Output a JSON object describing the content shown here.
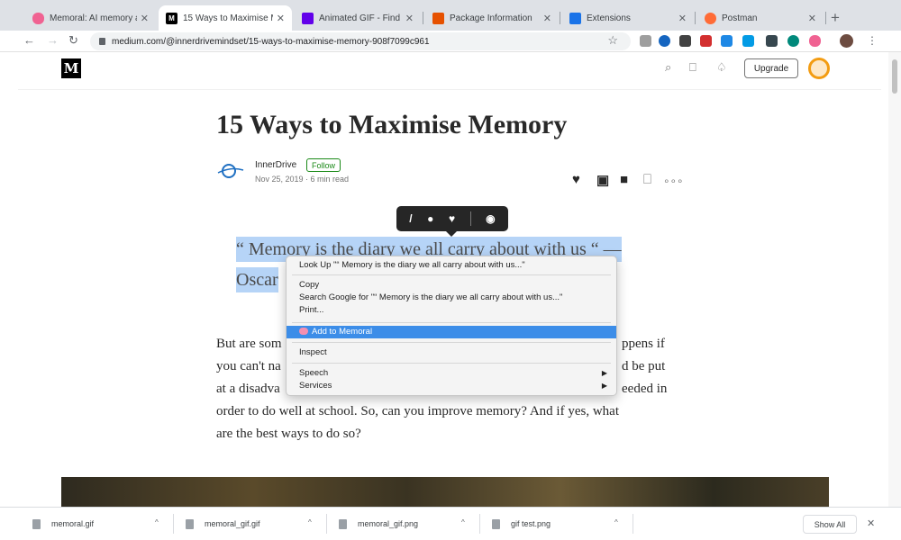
{
  "browser": {
    "tabs": [
      {
        "title": "Memoral: AI memory a",
        "favicon": "brain-icon",
        "color": "#f06292"
      },
      {
        "title": "15 Ways to Maximise M",
        "favicon": "medium-icon",
        "color": "#000000"
      },
      {
        "title": "Animated GIF - Find &",
        "favicon": "giphy-icon",
        "color": "#6200ea"
      },
      {
        "title": "Package Information",
        "favicon": "package-icon",
        "color": "#e65100"
      },
      {
        "title": "Extensions",
        "favicon": "puzzle-icon",
        "color": "#1a73e8"
      },
      {
        "title": "Postman",
        "favicon": "postman-icon",
        "color": "#ff6c37"
      }
    ],
    "tab_close": "✕",
    "new_tab": "+",
    "url": "medium.com/@innerdrivemindset/15-ways-to-maximise-memory-908f7099c961"
  },
  "medium": {
    "logo": "M",
    "upgrade_label": "Upgrade",
    "article": {
      "title": "15 Ways to Maximise Memory",
      "author": "InnerDrive",
      "follow_label": "Follow",
      "meta": "Nov 25, 2019 · 6 min read",
      "quote_lines": [
        "“ Memory is the diary we all carry about with us “ —",
        "Oscar"
      ],
      "paragraph_lines": [
        {
          "left": "But are som",
          "right": "ppens if"
        },
        {
          "left": "you can't na",
          "right": "d be put"
        },
        {
          "left": "at a disadva",
          "right": "eeded in"
        },
        {
          "full": "order to do well at school. So, can you improve memory? And if yes, what"
        },
        {
          "full": "are the best ways to do so?"
        }
      ]
    }
  },
  "context_menu": {
    "items": {
      "look_up": "Look Up \"“ Memory is the diary we all carry about with us...\"",
      "copy": "Copy",
      "search_google": "Search Google for \"“ Memory is the diary we all carry about with us...\"",
      "print": "Print...",
      "add_to_memoral": "Add to Memoral",
      "inspect": "Inspect",
      "speech": "Speech",
      "services": "Services"
    },
    "submenu_arrow": "▶"
  },
  "downloads": {
    "items": [
      "memoral.gif",
      "memoral_gif.gif",
      "memoral_gif.png",
      "gif test.png"
    ],
    "caret": "^",
    "show_all_label": "Show All",
    "close": "✕"
  }
}
